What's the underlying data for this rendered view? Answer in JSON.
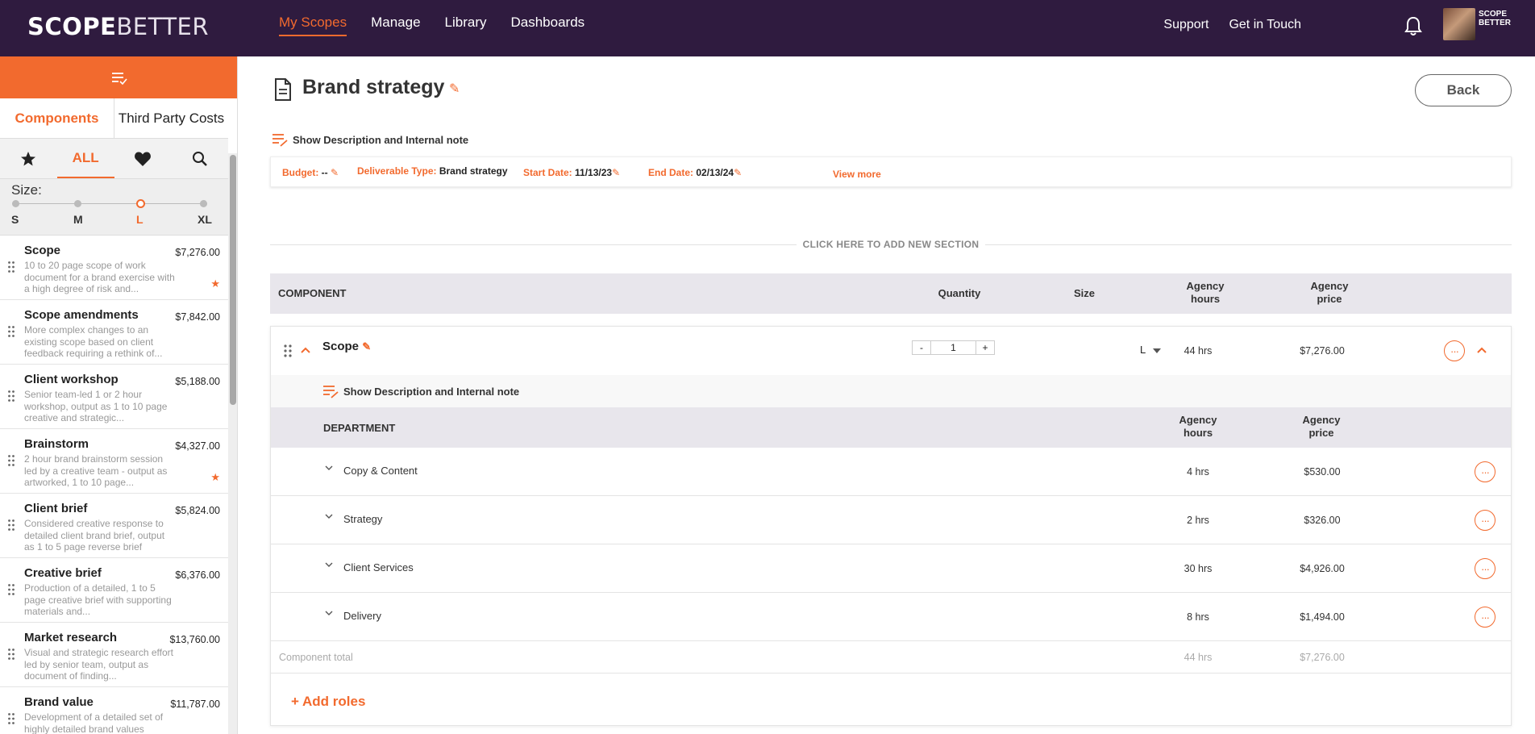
{
  "nav": {
    "logo_bold": "SCOPE",
    "logo_thin": "BETTER",
    "links": [
      "My Scopes",
      "Manage",
      "Library",
      "Dashboards"
    ],
    "right_links": [
      "Support",
      "Get in Touch"
    ],
    "avatar_label_1": "SCOPE",
    "avatar_label_2": "BETTER"
  },
  "sidebar": {
    "tabs": [
      "Components",
      "Third Party Costs"
    ],
    "filters": {
      "all": "ALL"
    },
    "size_label": "Size:",
    "sizes": [
      "S",
      "M",
      "L",
      "XL"
    ],
    "selected_size": "L",
    "items": [
      {
        "title": "Scope",
        "price": "$7,276.00",
        "desc": "10 to 20 page scope of work document for a brand exercise with a high degree of risk and...",
        "starred": true
      },
      {
        "title": "Scope amendments",
        "price": "$7,842.00",
        "desc": "More complex changes to an existing scope based on client feedback requiring a rethink of...",
        "starred": false
      },
      {
        "title": "Client workshop",
        "price": "$5,188.00",
        "desc": "Senior team-led 1 or 2 hour workshop, output as 1 to 10 page creative and strategic...",
        "starred": false
      },
      {
        "title": "Brainstorm",
        "price": "$4,327.00",
        "desc": "2 hour brand brainstorm session led by a creative team - output as artworked, 1 to 10 page...",
        "starred": true
      },
      {
        "title": "Client brief",
        "price": "$5,824.00",
        "desc": "Considered creative response to detailed client brand brief, output as 1 to 5 page reverse brief",
        "starred": false
      },
      {
        "title": "Creative brief",
        "price": "$6,376.00",
        "desc": "Production of a detailed, 1 to 5 page creative brief with supporting materials and...",
        "starred": false
      },
      {
        "title": "Market research",
        "price": "$13,760.00",
        "desc": "Visual and strategic research effort led by senior team, output as document of finding...",
        "starred": false
      },
      {
        "title": "Brand value",
        "price": "$11,787.00",
        "desc": "Development of a detailed set of highly detailed brand values",
        "starred": false
      }
    ]
  },
  "main": {
    "title": "Brand strategy",
    "back_label": "Back",
    "show_desc_label": "Show Description and Internal note",
    "info": {
      "budget_label": "Budget:",
      "budget_value": "--",
      "deliverable_label": "Deliverable Type:",
      "deliverable_value": "Brand strategy",
      "start_label": "Start Date:",
      "start_value": "11/13/23",
      "end_label": "End Date:",
      "end_value": "02/13/24",
      "view_more": "View more"
    },
    "add_section": "CLICK HERE TO ADD NEW SECTION",
    "table_headers": {
      "component": "COMPONENT",
      "quantity": "Quantity",
      "size": "Size",
      "hours_1": "Agency",
      "hours_2": "hours",
      "price_1": "Agency",
      "price_2": "price"
    },
    "component": {
      "name": "Scope",
      "quantity": "1",
      "minus": "-",
      "plus": "+",
      "size": "L",
      "hours": "44 hrs",
      "price": "$7,276.00",
      "show_desc_label": "Show Description and Internal note",
      "dept_header": "DEPARTMENT",
      "departments": [
        {
          "name": "Copy & Content",
          "hours": "4 hrs",
          "price": "$530.00"
        },
        {
          "name": "Strategy",
          "hours": "2 hrs",
          "price": "$326.00"
        },
        {
          "name": "Client Services",
          "hours": "30 hrs",
          "price": "$4,926.00"
        },
        {
          "name": "Delivery",
          "hours": "8 hrs",
          "price": "$1,494.00"
        }
      ],
      "total_label": "Component total",
      "total_hours": "44 hrs",
      "total_price": "$7,276.00",
      "add_roles": "+ Add roles"
    }
  },
  "colors": {
    "accent": "#f26a2e",
    "nav_bg": "#2f1b3f",
    "header_bg": "#e8e6ec"
  }
}
